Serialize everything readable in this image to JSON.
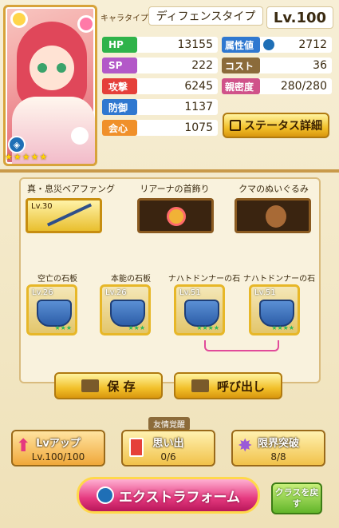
{
  "header": {
    "type_label": "キャラタイプ",
    "type_value": "ディフェンスタイプ",
    "level": "Lv.100"
  },
  "stats": [
    {
      "label": "HP",
      "value": "13155",
      "color": "#2fb34a"
    },
    {
      "label": "SP",
      "value": "222",
      "color": "#b358c8"
    },
    {
      "label": "攻撃",
      "value": "6245",
      "color": "#e5403a"
    },
    {
      "label": "防御",
      "value": "1137",
      "color": "#2f78d0"
    },
    {
      "label": "会心",
      "value": "1075",
      "color": "#f0902a"
    }
  ],
  "stats2": [
    {
      "label": "属性値",
      "value": "2712",
      "color": "#2f78d0"
    },
    {
      "label": "コスト",
      "value": "36",
      "color": "#8b6b3a"
    },
    {
      "label": "親密度",
      "value": "280/280",
      "color": "#d0528a"
    }
  ],
  "status_button": "ステータス詳細",
  "rarity_stars": 5,
  "equipment": {
    "weapon": {
      "title": "真・息災ベアファング",
      "level": "Lv.30"
    },
    "accessory": {
      "title": "リアーナの首飾り"
    },
    "item": {
      "title": "クマのぬいぐるみ"
    }
  },
  "tablets": [
    {
      "title": "空亡の石板",
      "level": "Lv.26"
    },
    {
      "title": "本能の石板",
      "level": "Lv.26"
    },
    {
      "title": "ナハトドンナーの石板",
      "level": "Lv.51"
    },
    {
      "title": "ナハトドンナーの石板",
      "level": "Lv.51"
    }
  ],
  "actions": {
    "save": "保 存",
    "load": "呼び出し"
  },
  "bottom": {
    "lvup_title": "Lvアップ",
    "lvup_value": "Lv.100/100",
    "friend_label": "友情覚醒",
    "memory_title": "思い出",
    "memory_value": "0/6",
    "limit_title": "限界突破",
    "limit_value": "8/8"
  },
  "extra_button": "エクストラフォーム",
  "class_button": "クラスを戻す"
}
